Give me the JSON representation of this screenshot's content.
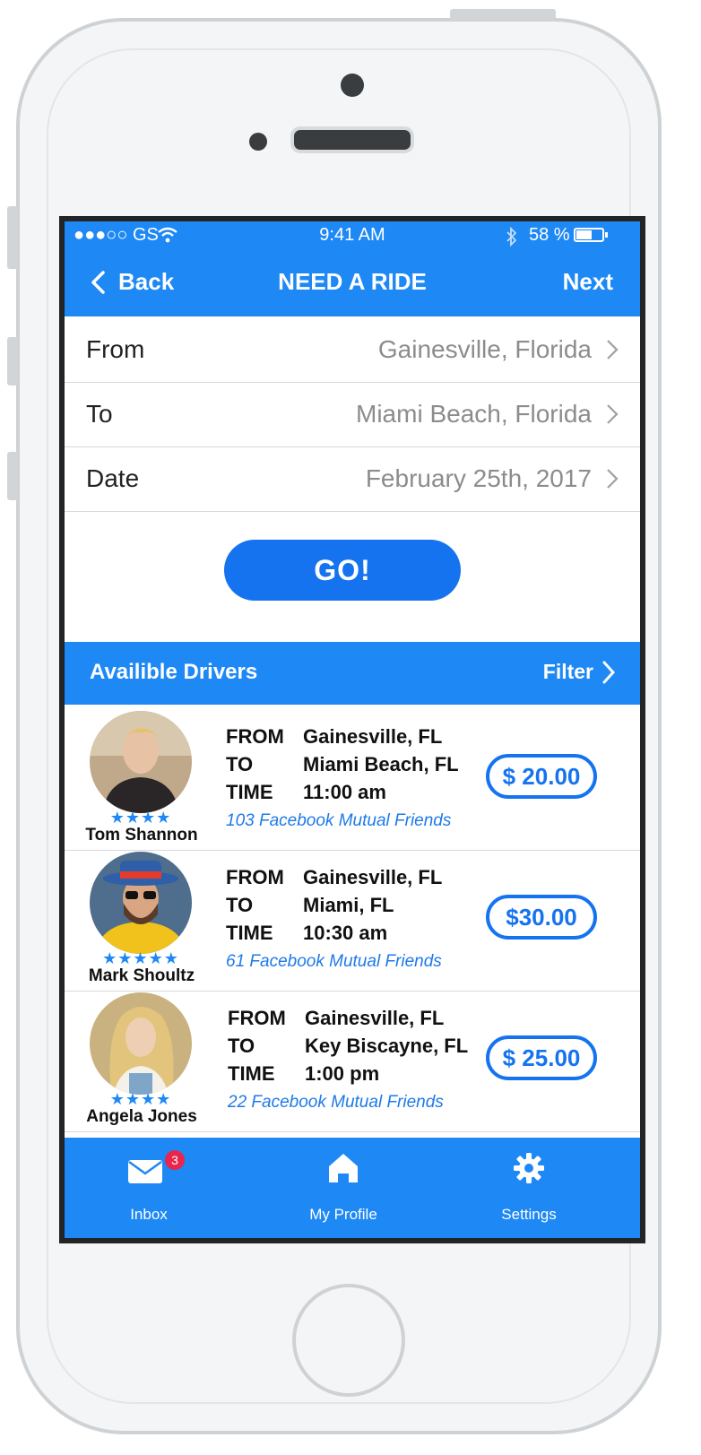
{
  "status": {
    "carrier": "●●●○○ GS",
    "time": "9:41 AM",
    "battery": "58 %"
  },
  "nav": {
    "back_label": "Back",
    "title": "NEED A RIDE",
    "next_label": "Next"
  },
  "form": {
    "from": {
      "label": "From",
      "value": "Gainesville, Florida"
    },
    "to": {
      "label": "To",
      "value": "Miami Beach, Florida"
    },
    "date": {
      "label": "Date",
      "value": "February 25th, 2017"
    },
    "go_label": "GO!"
  },
  "drivers_section": {
    "title": "Availible Drivers",
    "filter_label": "Filter"
  },
  "labels": {
    "from": "FROM",
    "to": "TO",
    "time": "TIME"
  },
  "drivers": [
    {
      "name": "Tom Shannon",
      "stars": "★★★★",
      "from": "Gainesville, FL",
      "to": "Miami Beach, FL",
      "time": "11:00 am",
      "mutual": "103 Facebook Mutual Friends",
      "price": "$ 20.00"
    },
    {
      "name": "Mark Shoultz",
      "stars": "★★★★★",
      "from": "Gainesville, FL",
      "to": "Miami, FL",
      "time": "10:30 am",
      "mutual": "61 Facebook Mutual Friends",
      "price": "$30.00"
    },
    {
      "name": "Angela Jones",
      "stars": "★★★★",
      "from": "Gainesville, FL",
      "to": "Key Biscayne, FL",
      "time": "1:00 pm",
      "mutual": "22 Facebook Mutual Friends",
      "price": "$ 25.00"
    }
  ],
  "tabs": {
    "inbox": "Inbox",
    "inbox_badge": "3",
    "profile": "My Profile",
    "settings": "Settings"
  },
  "colors": {
    "accent": "#1e88f5",
    "button": "#1673f0",
    "badge": "#e8254a"
  },
  "icons": [
    "wifi-icon",
    "bluetooth-icon",
    "battery-icon",
    "chevron-left-icon",
    "chevron-right-icon",
    "mail-icon",
    "home-icon",
    "gear-icon",
    "star-icon"
  ]
}
